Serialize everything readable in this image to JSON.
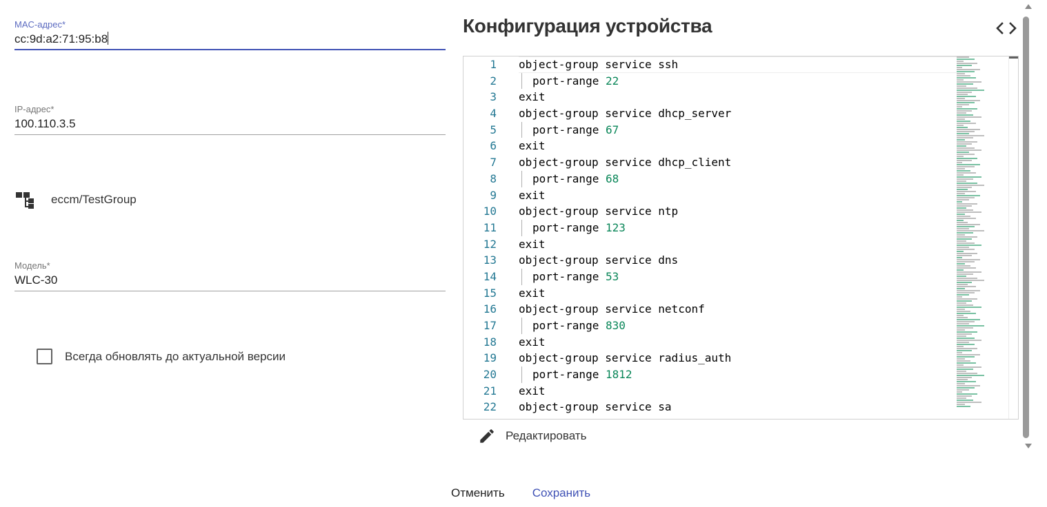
{
  "form": {
    "mac": {
      "label": "MAC-адрес*",
      "value": "cc:9d:a2:71:95:b8"
    },
    "ip": {
      "label": "IP-адрес*",
      "value": "100.110.3.5"
    },
    "group": {
      "icon": "tree-structure-icon",
      "path": "eccm/TestGroup"
    },
    "model": {
      "label": "Модель*",
      "value": "WLC-30"
    },
    "always_update": {
      "label": "Всегда обновлять до актуальной версии",
      "checked": false
    }
  },
  "config": {
    "title": "Конфигурация устройства",
    "toggle_icon": "code-brackets-icon",
    "lines": [
      {
        "n": "1",
        "indent": false,
        "text": "object-group service ssh",
        "num": ""
      },
      {
        "n": "2",
        "indent": true,
        "text": "port-range ",
        "num": "22"
      },
      {
        "n": "3",
        "indent": false,
        "text": "exit",
        "num": ""
      },
      {
        "n": "4",
        "indent": false,
        "text": "object-group service dhcp_server",
        "num": ""
      },
      {
        "n": "5",
        "indent": true,
        "text": "port-range ",
        "num": "67"
      },
      {
        "n": "6",
        "indent": false,
        "text": "exit",
        "num": ""
      },
      {
        "n": "7",
        "indent": false,
        "text": "object-group service dhcp_client",
        "num": ""
      },
      {
        "n": "8",
        "indent": true,
        "text": "port-range ",
        "num": "68"
      },
      {
        "n": "9",
        "indent": false,
        "text": "exit",
        "num": ""
      },
      {
        "n": "10",
        "indent": false,
        "text": "object-group service ntp",
        "num": ""
      },
      {
        "n": "11",
        "indent": true,
        "text": "port-range ",
        "num": "123"
      },
      {
        "n": "12",
        "indent": false,
        "text": "exit",
        "num": ""
      },
      {
        "n": "13",
        "indent": false,
        "text": "object-group service dns",
        "num": ""
      },
      {
        "n": "14",
        "indent": true,
        "text": "port-range ",
        "num": "53"
      },
      {
        "n": "15",
        "indent": false,
        "text": "exit",
        "num": ""
      },
      {
        "n": "16",
        "indent": false,
        "text": "object-group service netconf",
        "num": ""
      },
      {
        "n": "17",
        "indent": true,
        "text": "port-range ",
        "num": "830"
      },
      {
        "n": "18",
        "indent": false,
        "text": "exit",
        "num": ""
      },
      {
        "n": "19",
        "indent": false,
        "text": "object-group service radius_auth",
        "num": ""
      },
      {
        "n": "20",
        "indent": true,
        "text": "port-range ",
        "num": "1812"
      },
      {
        "n": "21",
        "indent": false,
        "text": "exit",
        "num": ""
      },
      {
        "n": "22",
        "indent": false,
        "text": "object-group service sa",
        "num": ""
      }
    ],
    "edit": {
      "icon": "pencil-icon",
      "label": "Редактировать"
    }
  },
  "actions": {
    "cancel": "Отменить",
    "save": "Сохранить"
  },
  "colors": {
    "accent": "#3f51b5",
    "line_number": "#237893",
    "number_literal": "#098658"
  }
}
